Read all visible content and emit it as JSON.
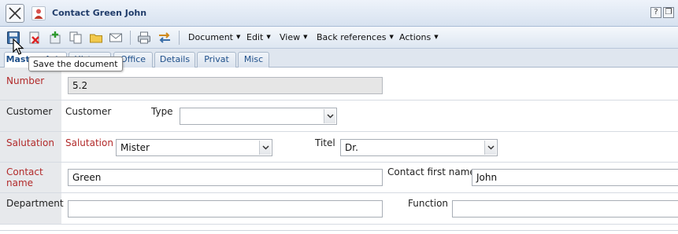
{
  "window": {
    "title": "Contact Green John",
    "help_label": "?",
    "window_label": "❐"
  },
  "toolbar": {
    "buttons": [
      "save-icon",
      "delete-icon",
      "add-icon",
      "copy-icon",
      "folder-icon",
      "mail-icon",
      "print-icon",
      "transfer-icon"
    ],
    "menus": [
      "Document",
      "Edit",
      "View",
      "Back references",
      "Actions"
    ]
  },
  "tooltip": "Save the document",
  "tabs": [
    "Master data",
    "History",
    "Office",
    "Details",
    "Privat",
    "Misc"
  ],
  "form": {
    "number": {
      "label": "Number",
      "value": "5.2"
    },
    "customer": {
      "label": "Customer",
      "text": "Customer",
      "type_label": "Type",
      "type_value": ""
    },
    "salutation": {
      "label": "Salutation",
      "inner_label": "Salutation",
      "value": "Mister",
      "titel_label": "Titel",
      "titel_value": "Dr."
    },
    "contact_name": {
      "label_line1": "Contact",
      "label_line2": "name",
      "value": "Green",
      "first_name_label": "Contact first name",
      "first_name_value": "John"
    },
    "department": {
      "label": "Department",
      "value": "",
      "function_label": "Function",
      "function_value": ""
    }
  },
  "colors": {
    "required_label": "#b22a2a",
    "tab_text": "#1e4f8a",
    "title_text": "#203c6a"
  }
}
